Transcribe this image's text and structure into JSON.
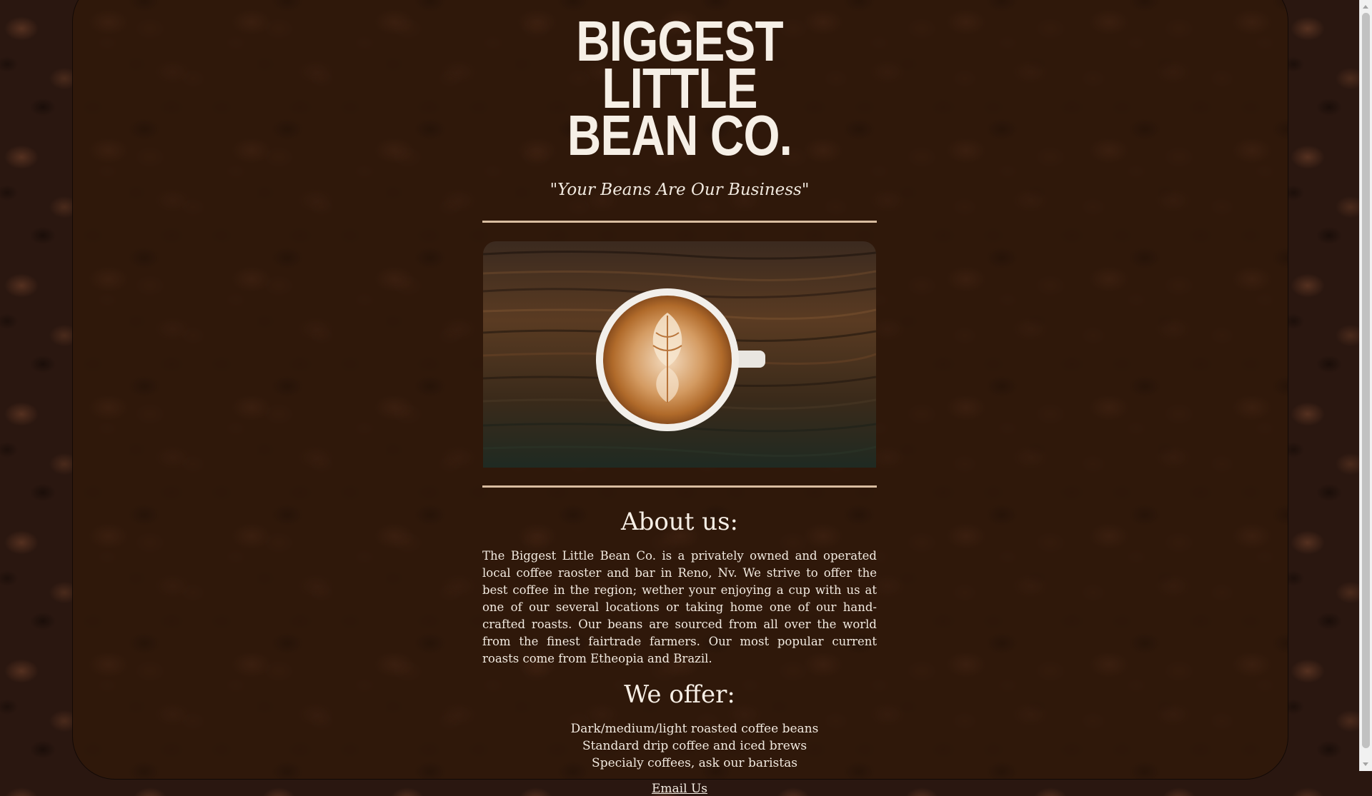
{
  "site": {
    "title_line1": "BIGGEST LITTLE",
    "title_line2": "BEAN CO.",
    "tagline": "\"Your Beans Are Our Business\""
  },
  "hero": {
    "image": "latte-art-coffee-cup-on-wood"
  },
  "about": {
    "heading": "About us:",
    "text": "The Biggest Little Bean Co. is a privately owned and operated local coffee raoster and bar in Reno, Nv. We strive to offer the best coffee in the region; wether your enjoying a cup with us at one of our several locations or taking home one of our hand-crafted roasts. Our beans are sourced from all over the world from the finest fairtrade farmers. Our most popular current roasts come from Etheopia and Brazil."
  },
  "offer": {
    "heading": "We offer:",
    "items": [
      "Dark/medium/light roasted coffee beans",
      "Standard drip coffee and iced brews",
      "Specialy coffees, ask our baristas"
    ]
  },
  "contact": {
    "email_label": "Email Us"
  },
  "colors": {
    "page_bg": "#2a1710",
    "panel_bg": "#30180a",
    "rule": "#d9bda0",
    "text": "#f3ece3"
  }
}
